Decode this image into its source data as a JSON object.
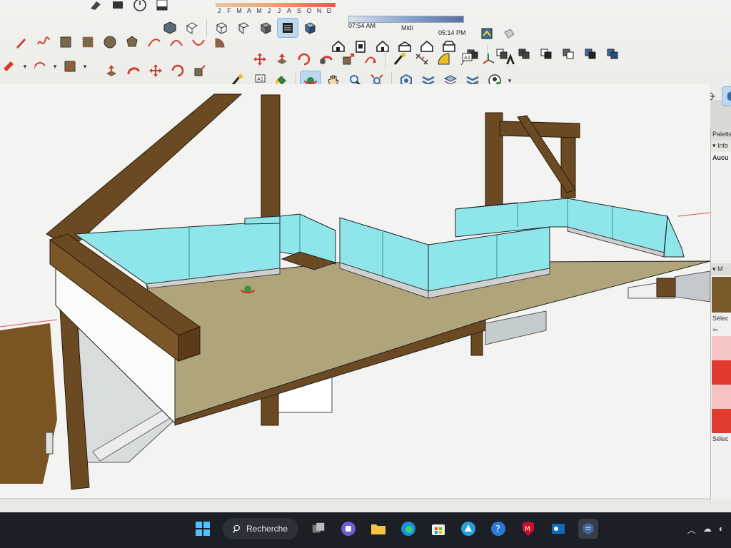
{
  "shadow_settings": {
    "months": [
      "J",
      "F",
      "M",
      "A",
      "M",
      "J",
      "J",
      "A",
      "S",
      "O",
      "N",
      "D"
    ],
    "time_start": "07:54 AM",
    "time_mid": "Midi",
    "time_end": "05:14 PM"
  },
  "right_tray": {
    "panel_title": "Palette",
    "entity_info_header": "Info",
    "entity_info_value": "Aucu",
    "materials_header": "M",
    "select_label": "Sélec",
    "select_label_2": "Sélec",
    "material_colors": [
      "#f6c6c6",
      "#e85a4a",
      "#f5c2c2",
      "#e03c30",
      "#e7a79d",
      "#d63428"
    ]
  },
  "taskbar": {
    "search_label": "Recherche",
    "icons": [
      "windows-start-icon",
      "search-icon",
      "task-view-icon",
      "teams-icon",
      "file-explorer-icon",
      "edge-icon",
      "store-icon",
      "photos-icon",
      "help-icon",
      "mcafee-icon",
      "outlook-icon",
      "sketchup-icon"
    ]
  },
  "colors": {
    "floor": "#b0a57a",
    "wood": "#6b4a23",
    "glass": "#8fe6ea",
    "viewport_bg": "#f4f4f2"
  }
}
